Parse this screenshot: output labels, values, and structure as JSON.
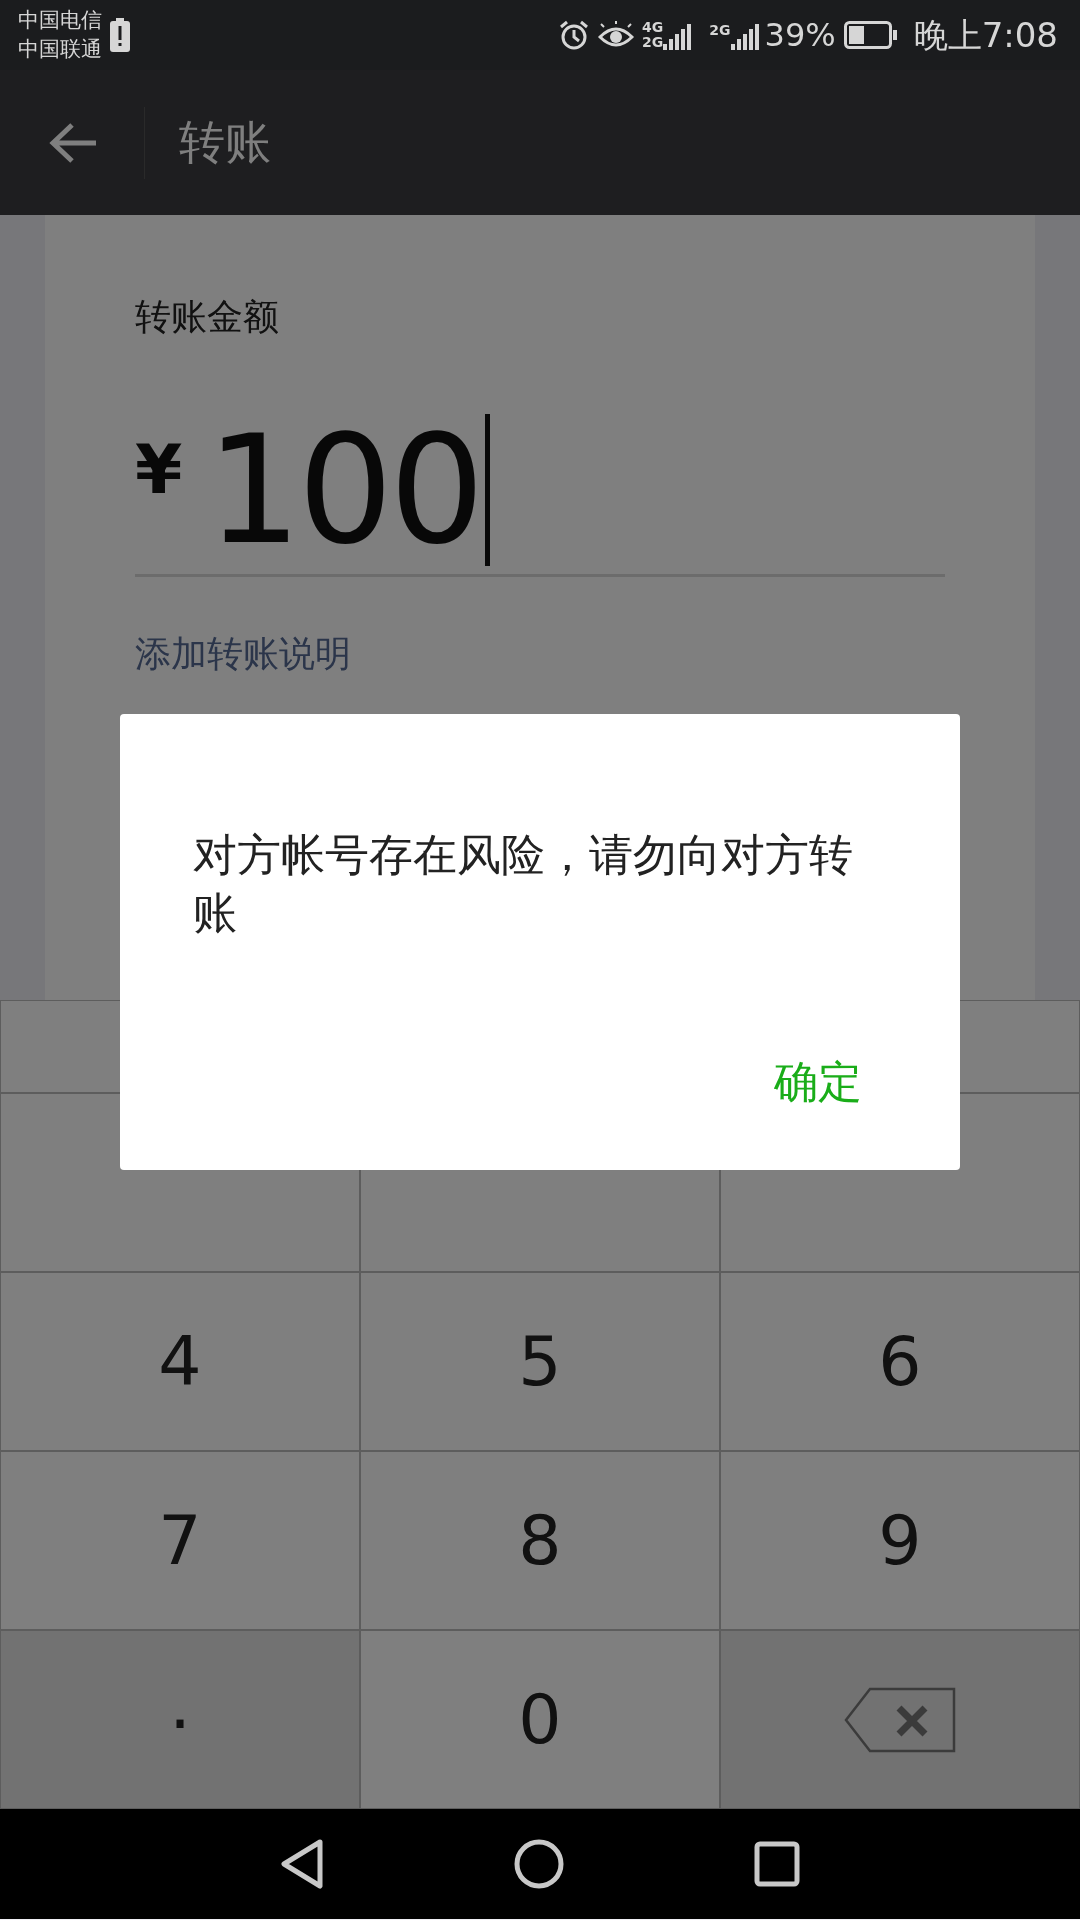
{
  "status_bar": {
    "carriers": [
      "中国电信",
      "中国联通"
    ],
    "network_labels": [
      "4G",
      "2G",
      "2G"
    ],
    "battery_percent": "39%",
    "time": "晚上7:08"
  },
  "app_bar": {
    "title": "转账"
  },
  "form": {
    "amount_label": "转账金额",
    "currency": "¥",
    "amount": "100",
    "note_link": "添加转账说明"
  },
  "keypad": [
    {
      "kind": "digit"
    },
    {
      "kind": "digit"
    },
    {
      "kind": "digit"
    },
    {
      "kind": "digit",
      "label": "4"
    },
    {
      "kind": "digit",
      "label": "5"
    },
    {
      "kind": "digit",
      "label": "6"
    },
    {
      "kind": "digit",
      "label": "7"
    },
    {
      "kind": "digit",
      "label": "8"
    },
    {
      "kind": "digit",
      "label": "9"
    },
    {
      "kind": "dot",
      "label": "."
    },
    {
      "kind": "digit",
      "label": "0"
    },
    {
      "kind": "delete"
    }
  ],
  "dialog": {
    "message": "对方帐号存在风险，请勿向对方转账",
    "button": "确定"
  }
}
